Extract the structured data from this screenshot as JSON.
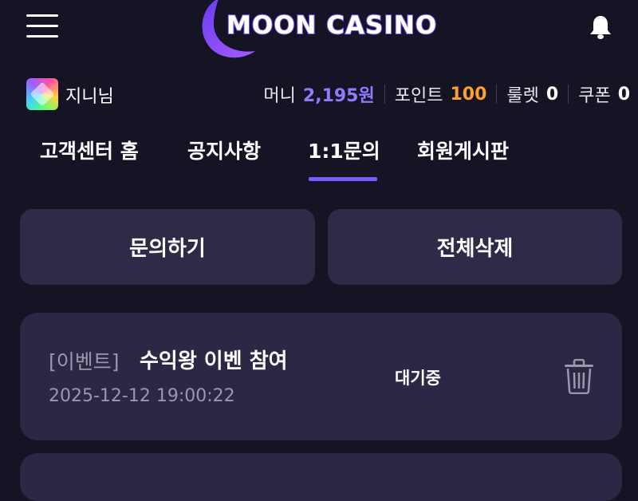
{
  "header": {
    "logo_text": "MOON CASINO"
  },
  "user": {
    "name": "지니님",
    "money_label": "머니",
    "money_value": "2,195원",
    "point_label": "포인트",
    "point_value": "100",
    "roulette_label": "룰렛",
    "roulette_value": "0",
    "coupon_label": "쿠폰",
    "coupon_value": "0"
  },
  "tabs": [
    {
      "label": "고객센터 홈"
    },
    {
      "label": "공지사항"
    },
    {
      "label": "1:1문의",
      "active": true
    },
    {
      "label": "회원게시판"
    }
  ],
  "actions": {
    "inquire_label": "문의하기",
    "delete_all_label": "전체삭제"
  },
  "inquiries": [
    {
      "category": "[이벤트]",
      "title": "수익왕 이벤 참여",
      "date": "2025-12-12 19:00:22",
      "status": "대기중"
    }
  ],
  "colors": {
    "background": "#151424",
    "card": "#2a2844",
    "button": "#2e2b48",
    "accent": "#7b5cff",
    "money": "#8f7bff",
    "point": "#ff9f2d"
  },
  "icons": {
    "menu": "hamburger-menu-icon",
    "bell": "bell-icon",
    "delete": "trash-icon",
    "logo": "crescent-moon-icon"
  }
}
